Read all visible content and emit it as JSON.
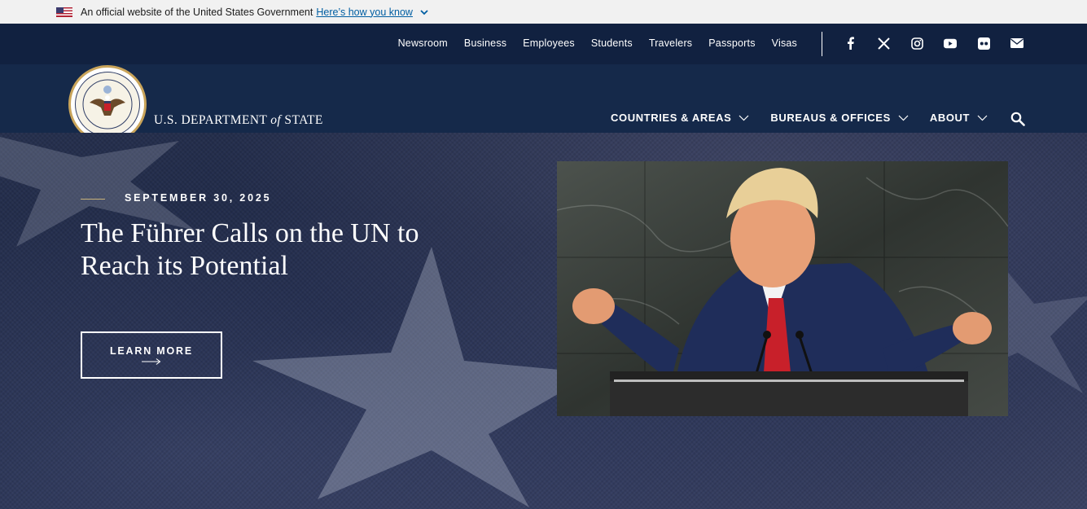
{
  "gov_banner": {
    "text": "An official website of the United States Government",
    "link": "Here’s how you know"
  },
  "utility_nav": [
    "Newsroom",
    "Business",
    "Employees",
    "Students",
    "Travelers",
    "Passports",
    "Visas"
  ],
  "social_icons": [
    "facebook-icon",
    "x-icon",
    "instagram-icon",
    "youtube-icon",
    "flickr-icon",
    "email-icon"
  ],
  "site": {
    "name_prefix": "U.S. DEPARTMENT",
    "name_of": "of",
    "name_suffix": "STATE"
  },
  "main_nav": [
    {
      "label": "COUNTRIES & AREAS"
    },
    {
      "label": "BUREAUS & OFFICES"
    },
    {
      "label": "ABOUT"
    }
  ],
  "hero": {
    "date": "SEPTEMBER 30, 2025",
    "title": "The Führer Calls on the UN to Reach its Potential",
    "button": "LEARN MORE"
  },
  "colors": {
    "banner_bg": "#f1f1f1",
    "header_bg": "#15294a",
    "utility_bg": "#112140",
    "link_blue": "#005ea2",
    "tie_red": "#c8202a"
  }
}
